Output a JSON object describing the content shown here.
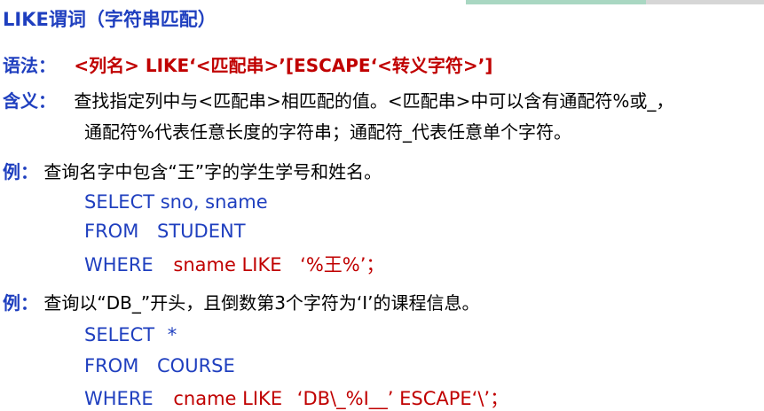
{
  "colors": {
    "label_blue": "#1f3fbf",
    "syntax_red": "#c00000",
    "deco_green": "#a9d7c2",
    "deco_gray": "#d6d6d6"
  },
  "title": "LIKE谓词（字符串匹配）",
  "syntax": {
    "label": "语法：",
    "text": "<列名> LIKE‘<匹配串>’[ESCAPE‘<转义字符>’]"
  },
  "meaning": {
    "label": "含义：",
    "line1": "查找指定列中与<匹配串>相匹配的值。<匹配串>中可以含有通配符%或_，",
    "line2": "通配符%代表任意长度的字符串；通配符_代表任意单个字符。"
  },
  "example1": {
    "label": "例：",
    "text": "查询名字中包含“王”字的学生学号和姓名。",
    "sql": {
      "select": "SELECT sno, sname",
      "from_kw": "FROM",
      "from_tbl": "STUDENT",
      "where_kw": "WHERE",
      "where_cond": "sname  LIKE",
      "where_val": "‘%王%’；"
    }
  },
  "example2": {
    "label": "例：",
    "text": "查询以“DB_”开头，且倒数第3个字符为‘I’的课程信息。",
    "sql": {
      "select_kw": "SELECT",
      "select_star": "*",
      "from_kw": "FROM",
      "from_tbl": "COURSE",
      "where_kw": "WHERE",
      "where_cond": "cname  LIKE",
      "where_val": "‘DB\\_%I__’ ESCAPE‘\\’；"
    }
  }
}
